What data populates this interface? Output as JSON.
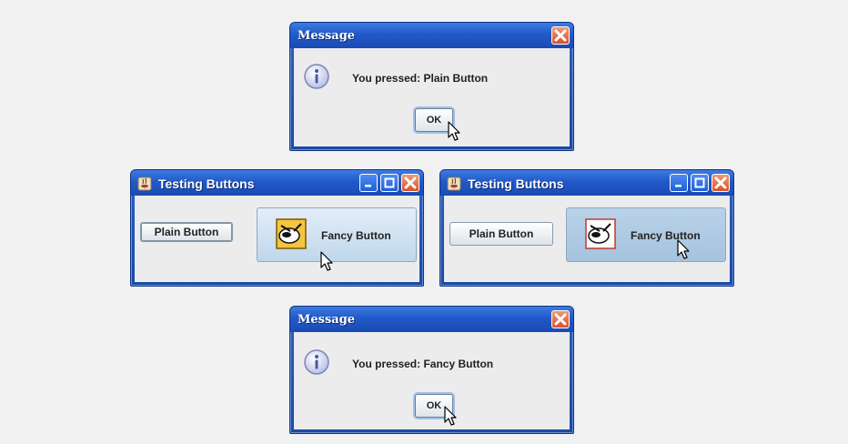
{
  "dialog_top": {
    "title": "Message",
    "message": "You pressed: Plain Button",
    "ok_label": "OK"
  },
  "window_left": {
    "title": "Testing Buttons",
    "plain_label": "Plain Button",
    "fancy_label": "Fancy Button"
  },
  "window_right": {
    "title": "Testing Buttons",
    "plain_label": "Plain Button",
    "fancy_label": "Fancy Button"
  },
  "dialog_bottom": {
    "title": "Message",
    "message": "You pressed: Fancy Button",
    "ok_label": "OK"
  },
  "icons": [
    "info-icon",
    "close-icon",
    "minimize-icon",
    "maximize-icon",
    "java-app-icon",
    "bug-icon",
    "mouse-cursor-icon"
  ],
  "colors": {
    "titlebar": "#2159c9",
    "frame": "#1a4aa8",
    "close_button": "#d9512b",
    "content_bg": "#ececec"
  }
}
